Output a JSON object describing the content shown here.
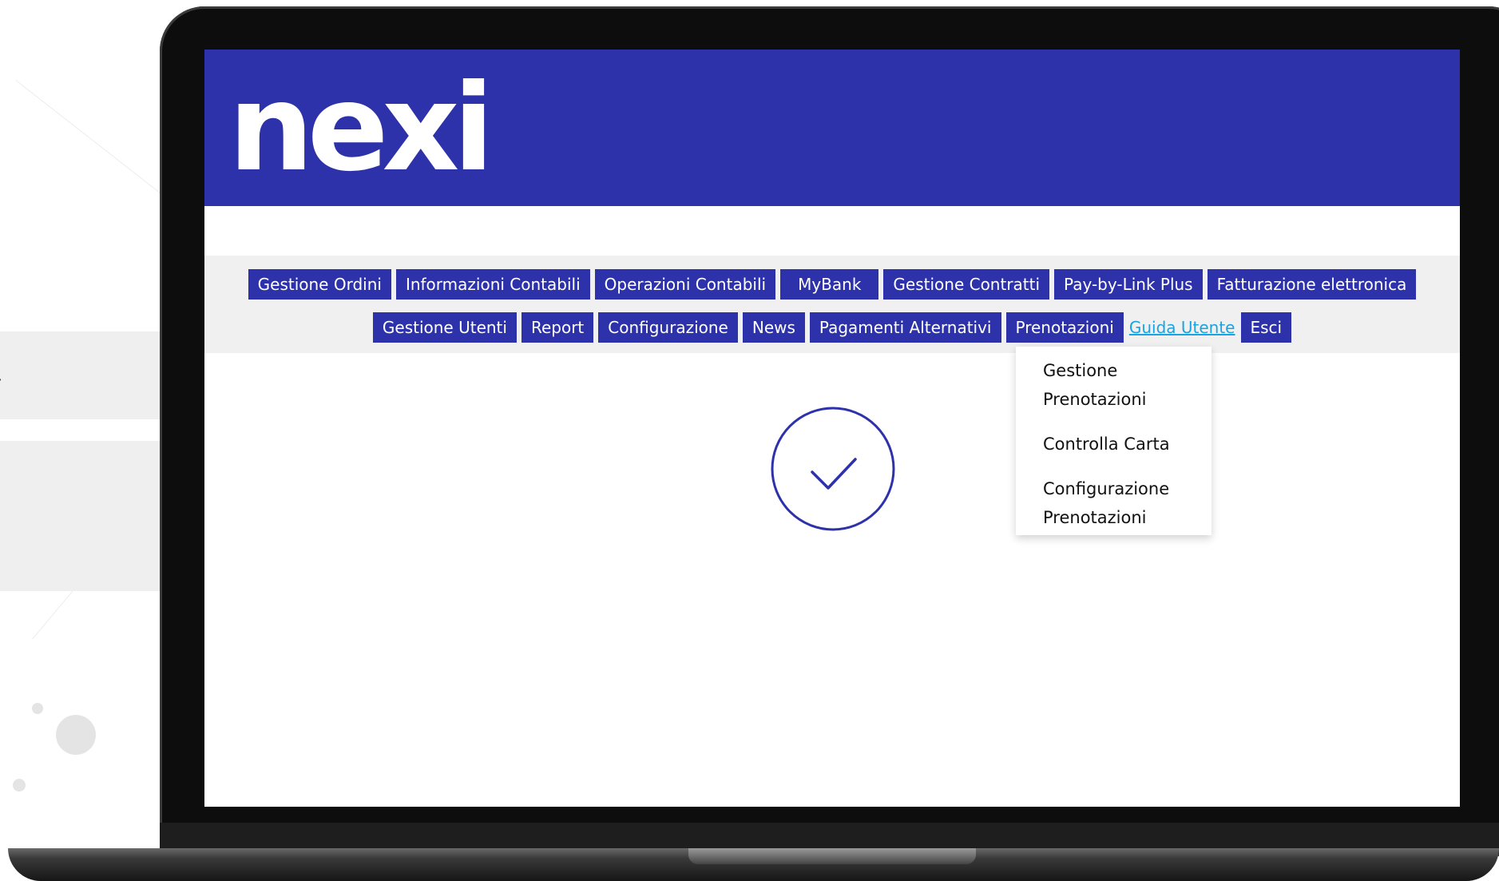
{
  "brand": {
    "logo_text": "nexi",
    "primary_color": "#2d32aa",
    "link_color": "#1aa3e0"
  },
  "nav": {
    "row1": [
      "Gestione Ordini",
      "Informazioni Contabili",
      "Operazioni Contabili",
      "MyBank",
      "Gestione Contratti",
      "Pay-by-Link Plus",
      "Fatturazione elettronica"
    ],
    "row2": {
      "gestione_utenti": "Gestione Utenti",
      "report": "Report",
      "configurazione": "Configurazione",
      "news": "News",
      "pagamenti_alternativi": "Pagamenti Alternativi",
      "prenotazioni": "Prenotazioni",
      "guida_utente": "Guida Utente",
      "esci": "Esci"
    }
  },
  "dropdown": {
    "items": [
      [
        "Gestione",
        "Prenotazioni"
      ],
      [
        "Controlla Carta"
      ],
      [
        "Configurazione",
        "Prenotazioni"
      ]
    ]
  },
  "status": {
    "icon": "check-circle-icon"
  }
}
